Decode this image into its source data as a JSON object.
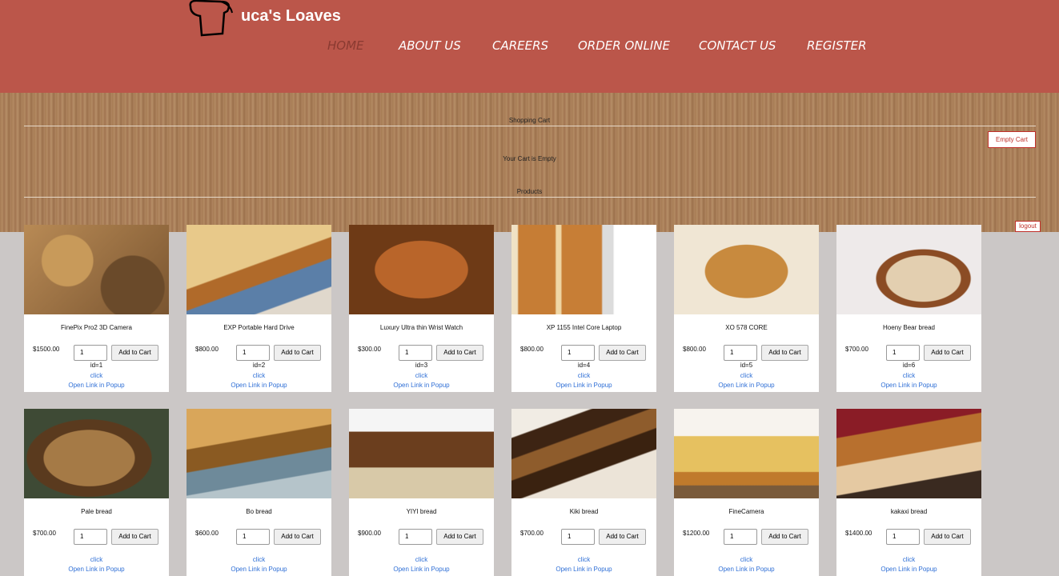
{
  "site": {
    "logo_text": "uca's Loaves"
  },
  "nav": [
    "HOME",
    "ABOUT US",
    "CAREERS",
    "ORDER ONLINE",
    "CONTACT US",
    "REGISTER"
  ],
  "cart": {
    "title": "Shopping Cart",
    "empty_text": "Your Cart is Empty",
    "empty_button": "Empty Cart"
  },
  "products_heading": "Products",
  "logout": "logout",
  "labels": {
    "add_to_cart": "Add to Cart",
    "click": "click",
    "popup": "Open Link in Popup",
    "qty_default": "1"
  },
  "products": [
    {
      "name": "FinePix Pro2 3D Camera",
      "price": "$1500.00",
      "id": "id=1"
    },
    {
      "name": "EXP Portable Hard Drive",
      "price": "$800.00",
      "id": "id=2"
    },
    {
      "name": "Luxury Ultra thin Wrist Watch",
      "price": "$300.00",
      "id": "id=3"
    },
    {
      "name": "XP 1155 Intel Core Laptop",
      "price": "$800.00",
      "id": "id=4"
    },
    {
      "name": "XO 578 CORE",
      "price": "$800.00",
      "id": "id=5"
    },
    {
      "name": "Hoeny Bear bread",
      "price": "$700.00",
      "id": "id=6"
    },
    {
      "name": "Pale bread",
      "price": "$700.00",
      "id": ""
    },
    {
      "name": "Bo bread",
      "price": "$600.00",
      "id": ""
    },
    {
      "name": "YIYI bread",
      "price": "$900.00",
      "id": ""
    },
    {
      "name": "Kiki bread",
      "price": "$700.00",
      "id": ""
    },
    {
      "name": "FineCamera",
      "price": "$1200.00",
      "id": ""
    },
    {
      "name": "kakaxi bread",
      "price": "$1400.00",
      "id": ""
    }
  ],
  "colors": {
    "header": "#bb564a",
    "link": "#2f6fd6",
    "accent_red": "#c0302a"
  }
}
